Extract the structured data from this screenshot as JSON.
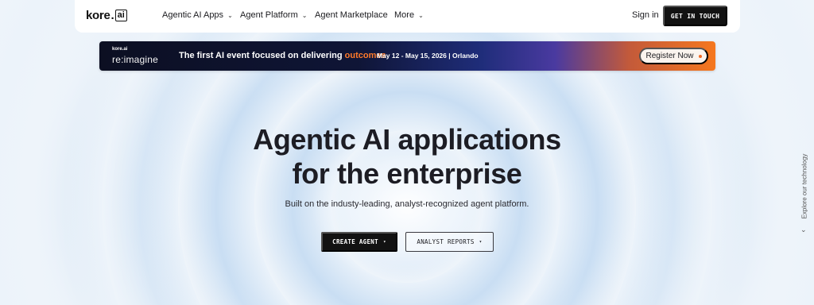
{
  "nav": {
    "logo_word": "kore",
    "logo_dot": ".",
    "logo_ai": "ai",
    "items": [
      {
        "label": "Agentic AI Apps",
        "chevron": "⌄"
      },
      {
        "label": "Agent Platform",
        "chevron": "⌄"
      },
      {
        "label": "Agent Marketplace",
        "chevron": ""
      },
      {
        "label": "More",
        "chevron": "⌄"
      }
    ],
    "sign_in": "Sign in",
    "cta": "GET IN TOUCH"
  },
  "banner": {
    "logo_small": "kore.ai",
    "logo_big": "re:imagine",
    "text_before": "The first AI event focused on delivering ",
    "text_highlight": "outcomes",
    "date": "May 12 - May 15, 2026 | Orlando",
    "register_label": "Register Now",
    "accent_color": "#f26a25"
  },
  "hero": {
    "title_line1": "Agentic AI applications",
    "title_line2": "for the enterprise",
    "subtitle": "Built on the industy-leading, analyst-recognized agent platform.",
    "primary_button": "CREATE AGENT",
    "secondary_button": "ANALYST REPORTS",
    "button_caret": "▾"
  },
  "side": {
    "explore_label": "Explore our technology",
    "chevron": "⌄"
  },
  "icons": {
    "nav_chevron": "chevron-down-icon",
    "register_dot": "dot-icon",
    "explore_chevron": "chevron-down-icon"
  }
}
